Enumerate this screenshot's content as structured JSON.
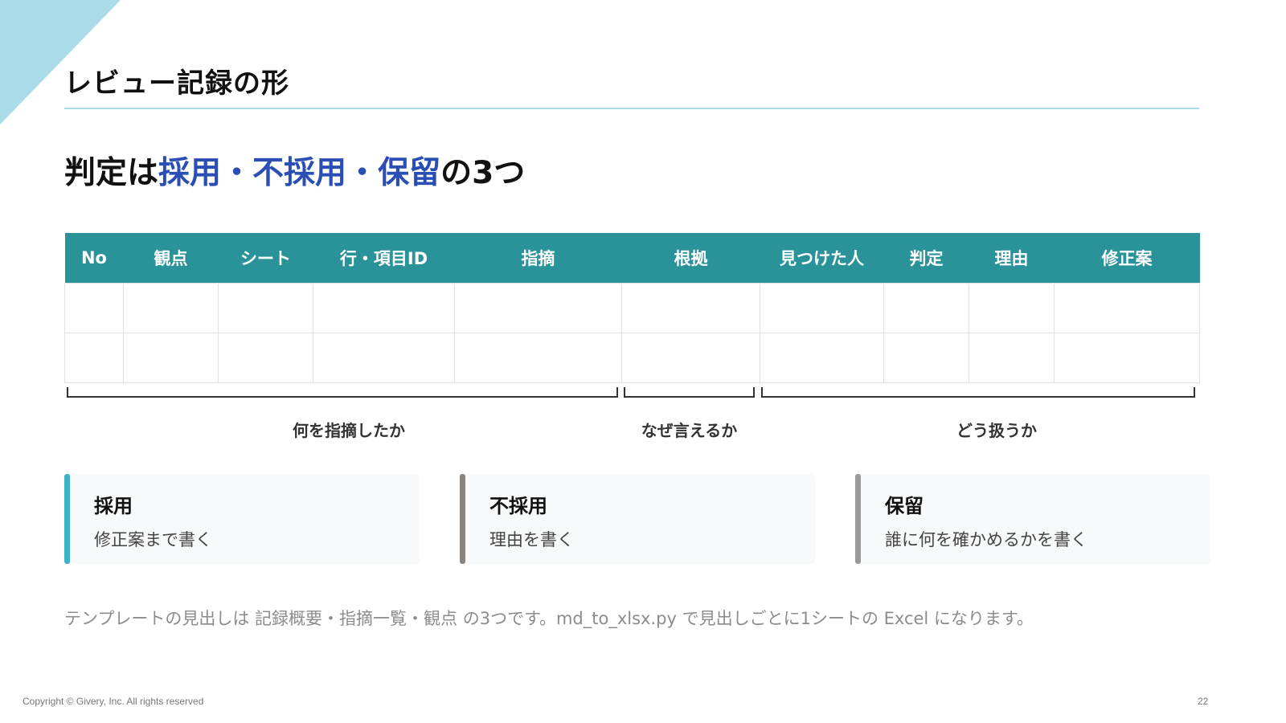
{
  "slide": {
    "title": "レビュー記録の形",
    "headline": {
      "prefix": "判定は",
      "accent1": "採用",
      "sep1": "・",
      "accent2": "不採用",
      "sep2": "・",
      "accent3": "保留",
      "suffix": "の3つ"
    },
    "colors": {
      "accent": "#2a4eb3",
      "table_header": "#2a9299",
      "corner": "#a9dbe8"
    }
  },
  "table": {
    "headers": [
      "No",
      "観点",
      "シート",
      "行・項目ID",
      "指摘",
      "根拠",
      "見つけた人",
      "判定",
      "理由",
      "修正案"
    ],
    "rows": [
      [
        "",
        "",
        "",
        "",
        "",
        "",
        "",
        "",
        "",
        ""
      ],
      [
        "",
        "",
        "",
        "",
        "",
        "",
        "",
        "",
        "",
        ""
      ]
    ]
  },
  "groups": [
    {
      "label": "何を指摘したか"
    },
    {
      "label": "なぜ言えるか"
    },
    {
      "label": "どう扱うか"
    }
  ],
  "cards": [
    {
      "title": "採用",
      "desc": "修正案まで書く",
      "color": "#3bb3c3"
    },
    {
      "title": "不採用",
      "desc": "理由を書く",
      "color": "#8a8580"
    },
    {
      "title": "保留",
      "desc": "誰に何を確かめるかを書く",
      "color": "#9a9a9a"
    }
  ],
  "note": "テンプレートの見出しは 記録概要・指摘一覧・観点 の3つです。md_to_xlsx.py で見出しごとに1シートの Excel になります。",
  "footer": {
    "copyright": "Copyright © Givery, Inc. All rights reserved",
    "page": "22"
  }
}
